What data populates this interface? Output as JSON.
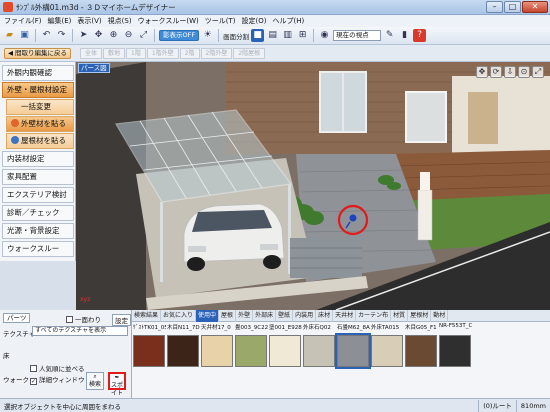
{
  "window": {
    "title": "ｻﾝﾌﾟﾙ外構01.m3d - ３Ｄマイホームデザイナー",
    "minimize_glyph": "–",
    "maximize_glyph": "□",
    "close_glyph": "✕"
  },
  "menu": [
    "ファイル(F)",
    "編集(E)",
    "表示(V)",
    "視点(S)",
    "ウォークスルー(W)",
    "ツール(T)",
    "設定(O)",
    "ヘルプ(H)"
  ],
  "toolbar": {
    "shadow_label": "影表示OFF",
    "screen_split_label": "画面分割",
    "viewpoint_select": "現在の視点",
    "icons": [
      "open-icon",
      "save-icon",
      "undo-icon",
      "redo-icon",
      "zoom-in-icon",
      "zoom-out-icon",
      "fit-icon"
    ]
  },
  "edit_bar": {
    "back_label": "間取り編集に戻る",
    "mode_tabs": [
      "全体",
      "敷地",
      "1階",
      "1階外壁",
      "2階",
      "2階外壁",
      "2階屋根"
    ]
  },
  "sidebar": {
    "items": [
      {
        "label": "外観内観確認",
        "style": "normal"
      },
      {
        "label": "外壁・屋根材設定",
        "style": "active"
      },
      {
        "label": "一括変更",
        "style": "sub-plain"
      },
      {
        "label": "外壁材を貼る",
        "style": "sub-active"
      },
      {
        "label": "屋根材を貼る",
        "style": "sub-plain"
      },
      {
        "label": "内装材設定",
        "style": "normal"
      },
      {
        "label": "家具配置",
        "style": "normal"
      },
      {
        "label": "エクステリア検討",
        "style": "normal"
      },
      {
        "label": "診断／チェック",
        "style": "normal"
      },
      {
        "label": "光源・背景設定",
        "style": "normal"
      },
      {
        "label": "ウォークスルー",
        "style": "normal"
      }
    ]
  },
  "viewport": {
    "view_label": "パース図",
    "axis_label": "xyz",
    "nav_icons": [
      "move-icon",
      "rotate-icon",
      "walk-icon",
      "zoom-icon",
      "fit-view-icon"
    ]
  },
  "parts_panel": {
    "tab_label": "パーツ",
    "single_sided_label": "一面わり",
    "settings_label": "設定",
    "texture_label": "テクスチャ",
    "texture_select": "すべてのテクスチャを表示",
    "popular_label": "人気順に並べる",
    "detail_window_label": "詳細ウィンドウ",
    "search_label": "検索",
    "eyedropper_label": "スポイト",
    "side_labels": [
      "床",
      "ウォーク"
    ]
  },
  "material_tabs": {
    "items": [
      "検索結果",
      "お気に入り",
      "使用中",
      "屋根",
      "外壁",
      "外部床",
      "壁紙",
      "内装用",
      "床材",
      "天井材",
      "カーテン布",
      "材質",
      "屋根材",
      "動材"
    ],
    "active_index": 2
  },
  "materials": [
    {
      "name": "ｹﾞｽﾄTK01_05",
      "color": "#7a2e1c"
    },
    {
      "name": "木目N11_7D",
      "color": "#3d2418"
    },
    {
      "name": "天井材17_0",
      "color": "#e8d3a8"
    },
    {
      "name": "畳003_9C22",
      "color": "#9aa86a"
    },
    {
      "name": "塗001_E928",
      "color": "#efe9d6"
    },
    {
      "name": "外床石Q02",
      "color": "#c7c2b6"
    },
    {
      "name": "石畳M62_8A",
      "color": "#8c8f96"
    },
    {
      "name": "外床TA015",
      "color": "#d8cdb6"
    },
    {
      "name": "木目G05_F1",
      "color": "#6b4a33"
    },
    {
      "name": "NR-F553T_C",
      "color": "#2f2f2f"
    }
  ],
  "status": {
    "text": "選択オブジェクトを中心に周囲をまわる",
    "route": "(0)ルート",
    "unit": "810mm"
  },
  "colors": {
    "accent_blue": "#2a62b8",
    "active_orange": "#e99a46",
    "highlight_red": "#e11a1a"
  }
}
